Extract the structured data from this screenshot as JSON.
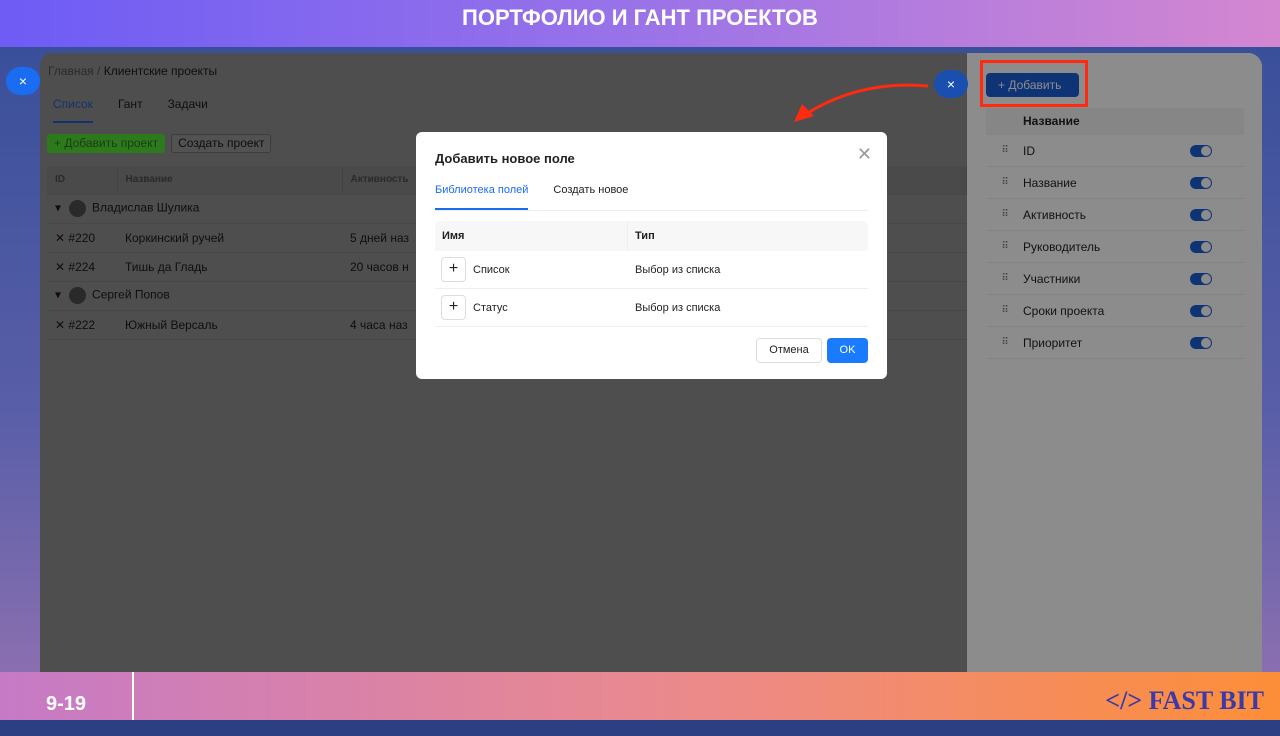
{
  "banner": {
    "title": "ПОРТФОЛИО И ГАНТ ПРОЕКТОВ"
  },
  "breadcrumb": {
    "home": "Главная",
    "sep": "/",
    "current": "Клиентские проекты"
  },
  "tabs": [
    {
      "label": "Список",
      "active": true
    },
    {
      "label": "Гант"
    },
    {
      "label": "Задачи"
    }
  ],
  "toolbar": {
    "add_project": "+ Добавить проект",
    "create_project": "Создать проект"
  },
  "table": {
    "headers": [
      "ID",
      "Название",
      "Активность"
    ],
    "groups": [
      {
        "owner": "Владислав Шулика",
        "rows": [
          {
            "id": "#220",
            "name": "Коркинский ручей",
            "activity": "5 дней наз"
          },
          {
            "id": "#224",
            "name": "Тишь да Гладь",
            "activity": "20 часов н"
          }
        ]
      },
      {
        "owner": "Сергей Попов",
        "rows": [
          {
            "id": "#222",
            "name": "Южный Версаль",
            "activity": "4 часа наз"
          }
        ]
      }
    ]
  },
  "close_icon": "×",
  "columns_panel": {
    "add_label": "+ Добавить",
    "header": "Название",
    "items": [
      {
        "label": "ID",
        "enabled": true
      },
      {
        "label": "Название",
        "enabled": true
      },
      {
        "label": "Активность",
        "enabled": true
      },
      {
        "label": "Руководитель",
        "enabled": true
      },
      {
        "label": "Участники",
        "enabled": true
      },
      {
        "label": "Сроки проекта",
        "enabled": true
      },
      {
        "label": "Приоритет",
        "enabled": true
      }
    ]
  },
  "modal": {
    "title": "Добавить новое поле",
    "tabs": [
      "Библиотека полей",
      "Создать новое"
    ],
    "headers": [
      "Имя",
      "Тип"
    ],
    "rows": [
      {
        "name": "Список",
        "type": "Выбор из списка"
      },
      {
        "name": "Статус",
        "type": "Выбор из списка"
      }
    ],
    "cancel": "Отмена",
    "ok": "OK"
  },
  "footer": {
    "page": "9-19",
    "logo": "</> FAST BIT"
  },
  "colors": {
    "accent": "#1a6df0",
    "highlight": "#ff2a10",
    "green": "#3eaa24"
  }
}
